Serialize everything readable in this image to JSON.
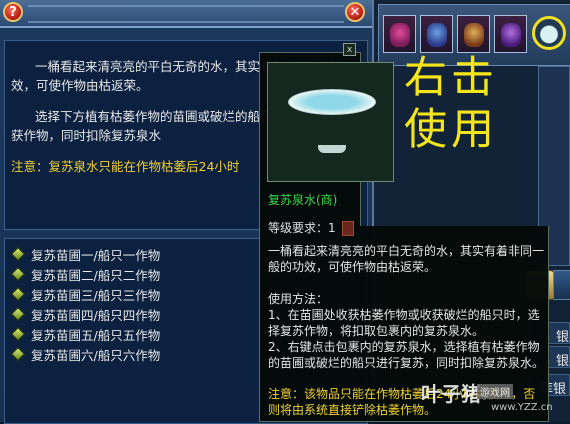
{
  "window": {
    "help_label": "?",
    "close_label": "✕"
  },
  "description": {
    "paragraph1": "一桶看起来清亮亮的平白无奇的水，其实有着非同一般的功效，可使作物由枯返荣。",
    "paragraph2": "选择下方植有枯萎作物的苗圃或破烂的船只进行复苏重新收获作物，同时扣除复苏泉水",
    "note": "注意：复苏泉水只能在作物枯萎后24小时"
  },
  "list": {
    "items": [
      {
        "label": "复苏苗圃一/船只一作物"
      },
      {
        "label": "复苏苗圃二/船只二作物"
      },
      {
        "label": "复苏苗圃三/船只三作物"
      },
      {
        "label": "复苏苗圃四/船只四作物"
      },
      {
        "label": "复苏苗圃五/船只五作物"
      },
      {
        "label": "复苏苗圃六/船只六作物"
      }
    ]
  },
  "tooltip": {
    "close_label": "x",
    "item_name": "复苏泉水(商)",
    "level_label": "等级要求：1",
    "description": "一桶看起来清亮亮的平白无奇的水，其实有着非同一般的功效，可使作物由枯返荣。",
    "usage_title": "使用方法：",
    "usage_1": "1、在苗圃处收获枯萎作物或收获破烂的船只时，选择复苏作物，将扣取包裹内的复苏泉水。",
    "usage_2": "2、右键点击包裹内的复苏泉水，选择植有枯萎作物的苗圃或破烂的船只进行复苏，同时扣除复苏泉水。",
    "note": "注意：该物品只能在作物枯萎后24小时内使用，否则将由系统直接铲除枯萎作物。"
  },
  "annotation": {
    "line1": "右击",
    "line2": "使用"
  },
  "side": {
    "labels": [
      "银",
      "银",
      "库银"
    ]
  },
  "watermark": {
    "brand": "叶子猪",
    "tag": "游戏网",
    "url": "www.YZZ.cn"
  }
}
